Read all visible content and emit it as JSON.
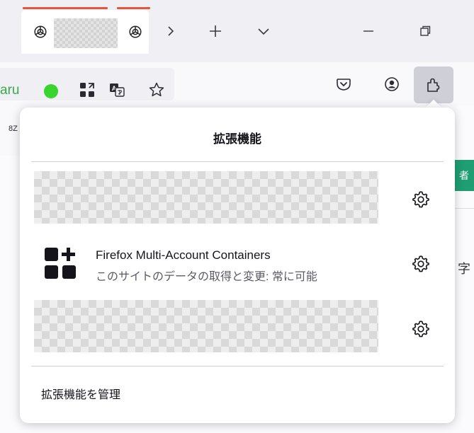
{
  "toolbar": {
    "user_text": "aru"
  },
  "bookmarks": {
    "fragment": "8Z"
  },
  "page_right": {
    "button_fragment": "者",
    "text_fragment": "字"
  },
  "panel": {
    "title": "拡張機能",
    "extension": {
      "name": "Firefox Multi-Account Containers",
      "permission": "このサイトのデータの取得と変更: 常に可能"
    },
    "manage_label": "拡張機能を管理"
  },
  "colors": {
    "tab_accent": "#e8553e",
    "user_green": "#38d52e",
    "active_button": "#cfcfd8"
  },
  "icons": {
    "tab_favicon": "openai-icon",
    "tab_overflow": "chevron-right-icon",
    "new_tab": "plus-icon",
    "tab_list": "chevron-down-icon",
    "minimize": "minimize-icon",
    "restore": "restore-icon",
    "qr": "qr-code-icon",
    "translate": "translate-icon",
    "bookmark": "star-icon",
    "pocket": "pocket-icon",
    "account": "account-icon",
    "extensions": "puzzle-icon",
    "settings": "gear-icon",
    "containers": "multi-account-containers-icon"
  }
}
